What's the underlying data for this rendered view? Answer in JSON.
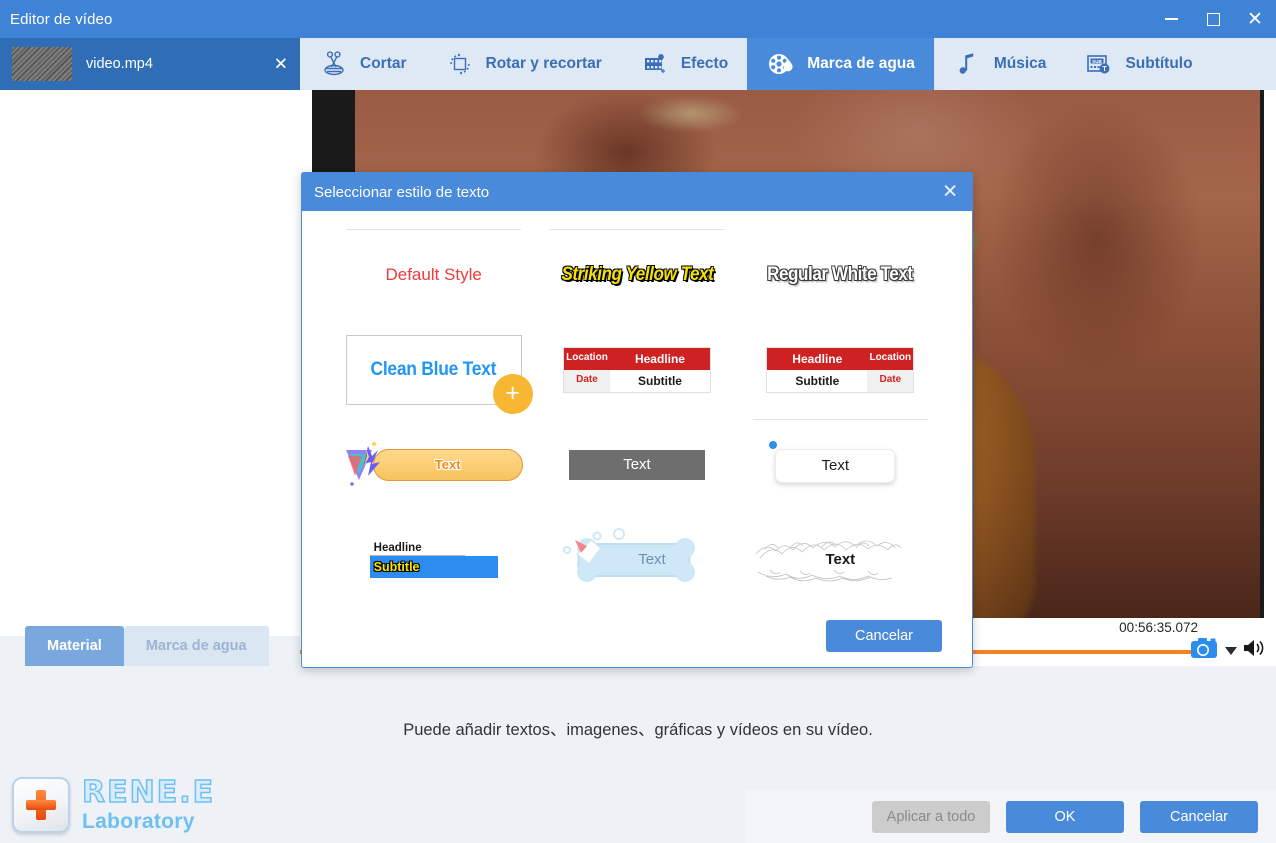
{
  "window": {
    "title": "Editor de vídeo",
    "minimize_icon": "minimize-icon",
    "maximize_icon": "maximize-icon",
    "close_icon": "close-icon"
  },
  "sidebar": {
    "file": {
      "name": "video.mp4",
      "close_label": "✕"
    }
  },
  "toolbar": {
    "tabs": [
      {
        "label": "Cortar",
        "icon": "scissors-icon",
        "active": false
      },
      {
        "label": "Rotar y recortar",
        "icon": "rotate-crop-icon",
        "active": false
      },
      {
        "label": "Efecto",
        "icon": "film-effect-icon",
        "active": false
      },
      {
        "label": "Marca de agua",
        "icon": "watermark-icon",
        "active": true
      },
      {
        "label": "Música",
        "icon": "music-note-icon",
        "active": false
      },
      {
        "label": "Subtítulo",
        "icon": "subtitle-icon",
        "active": false
      }
    ]
  },
  "timeline": {
    "current_time": "00:56:35.072",
    "progress_percent": 100,
    "snapshot_icon": "camera-icon",
    "dropdown_icon": "caret-down-icon",
    "volume_icon": "speaker-icon"
  },
  "bottom_tabs": [
    {
      "label": "Material",
      "active": true
    },
    {
      "label": "Marca de agua",
      "active": false
    }
  ],
  "lower_panel": {
    "hint": "Puede añadir textos、imagenes、gráficas y vídeos en su vídeo.",
    "brand_name": "RENE.E",
    "brand_sub": "Laboratory",
    "buttons": {
      "apply_all": "Aplicar a todo",
      "ok": "OK",
      "cancel": "Cancelar"
    }
  },
  "dialog": {
    "title": "Seleccionar estilo de texto",
    "close_label": "✕",
    "cancel_label": "Cancelar",
    "styles": [
      {
        "id": "default-style",
        "kind": "plain",
        "text": "Default Style",
        "divider": true,
        "selected": false
      },
      {
        "id": "striking-yellow-text",
        "kind": "outline-yellow",
        "text": "Striking Yellow Text",
        "divider": true,
        "selected": false
      },
      {
        "id": "regular-white-text",
        "kind": "outline-white",
        "text": "Regular White Text",
        "divider": false,
        "selected": false
      },
      {
        "id": "clean-blue-text",
        "kind": "boxed-blue",
        "text": "Clean Blue Text",
        "divider": false,
        "selected": true,
        "badge": "+"
      },
      {
        "id": "table-left-location",
        "kind": "table",
        "reversed": false,
        "headline": "Headline",
        "location": "Location",
        "date": "Date",
        "subtitle": "Subtitle",
        "divider": false,
        "selected": false
      },
      {
        "id": "table-right-location",
        "kind": "table",
        "reversed": true,
        "headline": "Headline",
        "location": "Location",
        "date": "Date",
        "subtitle": "Subtitle",
        "divider": false,
        "selected": false
      },
      {
        "id": "ribbon-burst-text",
        "kind": "ribbon",
        "text": "Text",
        "divider": false,
        "selected": false
      },
      {
        "id": "gray-bar-text",
        "kind": "gray-bar",
        "text": "Text",
        "divider": false,
        "selected": false
      },
      {
        "id": "card-dot-text",
        "kind": "card-dot",
        "text": "Text",
        "divider": true,
        "selected": false
      },
      {
        "id": "headline-subtitle-banner",
        "kind": "banner",
        "headline": "Headline",
        "subtitle": "Subtitle",
        "divider": false,
        "selected": false
      },
      {
        "id": "bone-cloud-text",
        "kind": "bone",
        "text": "Text",
        "divider": false,
        "selected": false
      },
      {
        "id": "grass-brush-text",
        "kind": "grass",
        "text": "Text",
        "divider": false,
        "selected": false
      }
    ]
  },
  "colors": {
    "accent": "#4a8ada",
    "titlebar": "#3f83d6",
    "toolbar_bg": "#dfe9f5",
    "progress": "#f58220",
    "badge": "#f7b733",
    "red": "#ce2222",
    "yellow": "#f5e10a"
  }
}
